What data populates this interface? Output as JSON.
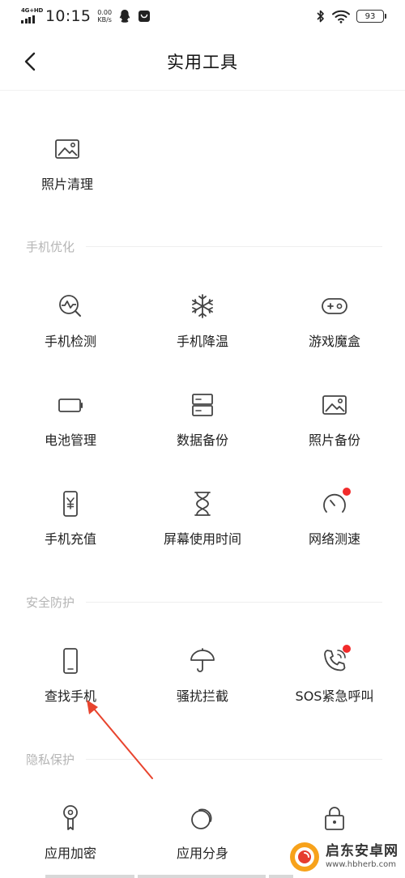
{
  "status_bar": {
    "network": "4G+HD",
    "time": "10:15",
    "speed_value": "0.00",
    "speed_unit": "KB/s",
    "battery": "93"
  },
  "header": {
    "title": "实用工具"
  },
  "top": {
    "photo_clean": "照片清理"
  },
  "sections": {
    "phone_optimize": {
      "title": "手机优化",
      "items": [
        "手机检测",
        "手机降温",
        "游戏魔盒",
        "电池管理",
        "数据备份",
        "照片备份",
        "手机充值",
        "屏幕使用时间",
        "网络测速"
      ]
    },
    "security": {
      "title": "安全防护",
      "items": [
        "查找手机",
        "骚扰拦截",
        "SOS紧急呼叫"
      ]
    },
    "privacy": {
      "title": "隐私保护",
      "items": [
        "应用加密",
        "应用分身"
      ]
    }
  },
  "watermark": {
    "name": "启东安卓网",
    "url": "www.hbherb.com"
  },
  "colors": {
    "badge": "#f22b2b",
    "arrow": "#e8442e",
    "section_title": "#b5b5b5"
  }
}
